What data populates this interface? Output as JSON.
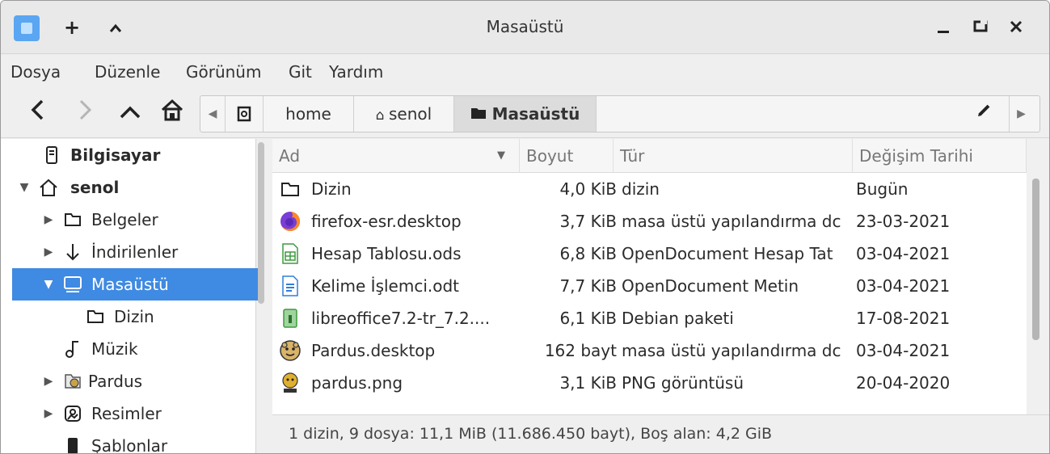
{
  "window": {
    "title": "Masaüstü",
    "add_label": "+",
    "up_label": "^",
    "minimize_label": "_",
    "maximize_label": "▭",
    "close_label": "✕"
  },
  "menu": [
    "Dosya",
    "Düzenle",
    "Görünüm",
    "Git",
    "Yardım"
  ],
  "toolbar": {
    "path": [
      "home",
      "senol",
      "Masaüstü"
    ]
  },
  "sidebar": {
    "items": [
      {
        "label": "Bilgisayar",
        "icon": "computer-icon",
        "bold": true
      },
      {
        "label": "senol",
        "icon": "home-icon",
        "bold": true,
        "expanded": true
      },
      {
        "label": "Belgeler",
        "icon": "folder-icon"
      },
      {
        "label": "İndirilenler",
        "icon": "download-icon"
      },
      {
        "label": "Masaüstü",
        "icon": "desktop-icon",
        "selected": true,
        "expanded": true
      },
      {
        "label": "Dizin",
        "icon": "folder-icon"
      },
      {
        "label": "Müzik",
        "icon": "music-icon"
      },
      {
        "label": "Pardus",
        "icon": "pardus-folder-icon"
      },
      {
        "label": "Resimler",
        "icon": "pictures-icon"
      },
      {
        "label": "Şablonlar",
        "icon": "templates-icon"
      }
    ]
  },
  "columns": {
    "name": "Ad",
    "size": "Boyut",
    "type": "Tür",
    "modified": "Değişim Tarihi"
  },
  "files": [
    {
      "name": "Dizin",
      "size": "4,0 KiB",
      "type": "dizin",
      "modified": "Bugün",
      "icon": "folder-icon"
    },
    {
      "name": "firefox-esr.desktop",
      "size": "3,7 KiB",
      "type": "masa üstü yapılandırma dc",
      "modified": "23-03-2021",
      "icon": "firefox-icon"
    },
    {
      "name": "Hesap Tablosu.ods",
      "size": "6,8 KiB",
      "type": "OpenDocument Hesap Tat",
      "modified": "03-04-2021",
      "icon": "spreadsheet-icon"
    },
    {
      "name": "Kelime İşlemci.odt",
      "size": "7,7 KiB",
      "type": "OpenDocument Metin",
      "modified": "03-04-2021",
      "icon": "document-icon"
    },
    {
      "name": "libreoffice7.2-tr_7.2....",
      "size": "6,1 KiB",
      "type": "Debian paketi",
      "modified": "17-08-2021",
      "icon": "package-icon"
    },
    {
      "name": "Pardus.desktop",
      "size": "162 bayt",
      "type": "masa üstü yapılandırma dc",
      "modified": "03-04-2021",
      "icon": "pardus-icon"
    },
    {
      "name": "pardus.png",
      "size": "3,1 KiB",
      "type": "PNG görüntüsü",
      "modified": "20-04-2020",
      "icon": "pardus-png-icon"
    }
  ],
  "status": "1 dizin, 9 dosya: 11,1 MiB (11.686.450 bayt), Boş alan: 4,2 GiB",
  "colors": {
    "selection": "#3f8ae2",
    "app_icon": "#5aa6f2"
  }
}
